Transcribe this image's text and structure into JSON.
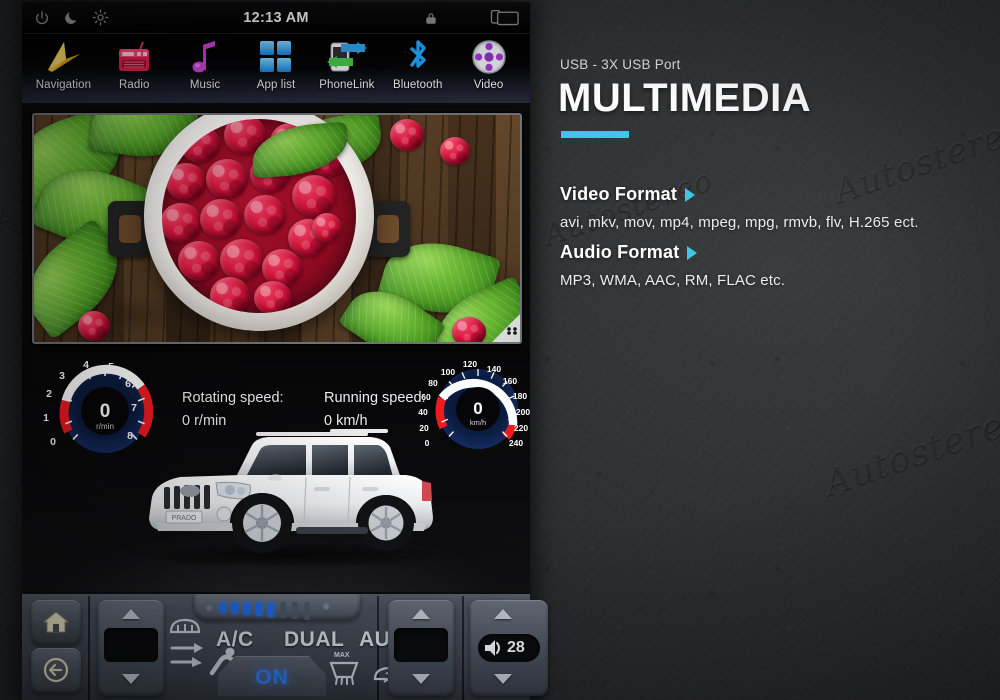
{
  "brand_watermark": "Autostereo",
  "colors": {
    "accent_cyan": "#3dc6e8",
    "headline_white": "#ffffff",
    "page_background": "#313234",
    "climate_blue": "#2f7ff5"
  },
  "head_unit": {
    "status_bar": {
      "time": "12:13 AM",
      "left_icons": [
        {
          "name": "power-icon",
          "label": "Power"
        },
        {
          "name": "moon-icon",
          "label": "Night mode"
        },
        {
          "name": "brightness-icon",
          "label": "Brightness"
        }
      ],
      "right_icons": [
        {
          "name": "lock-icon",
          "label": "Screen lock"
        },
        {
          "name": "recent-apps-icon",
          "label": "Recent apps"
        }
      ]
    },
    "dock": {
      "items": [
        {
          "label": "Navigation",
          "icon": "navigation-arrow-icon"
        },
        {
          "label": "Radio",
          "icon": "radio-icon"
        },
        {
          "label": "Music",
          "icon": "music-note-icon"
        },
        {
          "label": "App list",
          "icon": "app-grid-icon"
        },
        {
          "label": "PhoneLink",
          "icon": "phonelink-icon"
        },
        {
          "label": "Bluetooth",
          "icon": "bluetooth-icon"
        },
        {
          "label": "Video",
          "icon": "video-reel-icon"
        }
      ]
    },
    "video_window": {
      "content_description": "Bowl of fresh raspberries with leaves on wooden boards",
      "resize_handle": "resize-handle"
    },
    "dashboard": {
      "rotating_speed": {
        "caption": "Rotating speed:",
        "value": "0 r/min",
        "gauge_value": "0",
        "gauge_unit": "r/min",
        "ticks": [
          "0",
          "1",
          "2",
          "3",
          "4",
          "5",
          "6",
          "7",
          "8"
        ]
      },
      "running_speed": {
        "caption": "Running speed:",
        "value": "0 km/h",
        "gauge_value": "0",
        "gauge_unit": "km/h",
        "ticks": [
          "0",
          "20",
          "40",
          "60",
          "80",
          "100",
          "120",
          "140",
          "160",
          "180",
          "200",
          "220",
          "240"
        ]
      },
      "vehicle": "White SUV (Toyota Land Cruiser Prado)"
    },
    "climate_bar": {
      "home_button": "home-icon",
      "back_button": "back-arrow-icon",
      "left_temp_display": "",
      "right_temp_display": "",
      "fan_level": 5,
      "fan_segments": 8,
      "controls": [
        {
          "label": "A/C",
          "name": "ac-button"
        },
        {
          "label": "DUAL",
          "name": "dual-button"
        },
        {
          "label": "AUTO",
          "name": "auto-button"
        }
      ],
      "power_state": "ON",
      "max_label": "MAX",
      "volume_value": "28",
      "volume_icon": "speaker-icon",
      "icon_buttons": [
        {
          "name": "air-recirculate-icon"
        },
        {
          "name": "seat-airflow-icon"
        },
        {
          "name": "front-defrost-icon"
        },
        {
          "name": "rear-defrost-icon"
        },
        {
          "name": "windshield-defog-icon"
        }
      ]
    }
  },
  "info_panel": {
    "kicker": "USB - 3X USB Port",
    "headline": "MULTIMEDIA",
    "sections": [
      {
        "title": "Video Format",
        "body": "avi, mkv, mov, mp4, mpeg, mpg, rmvb, flv, H.265 ect."
      },
      {
        "title": "Audio Format",
        "body": "MP3, WMA, AAC, RM, FLAC etc."
      }
    ]
  }
}
